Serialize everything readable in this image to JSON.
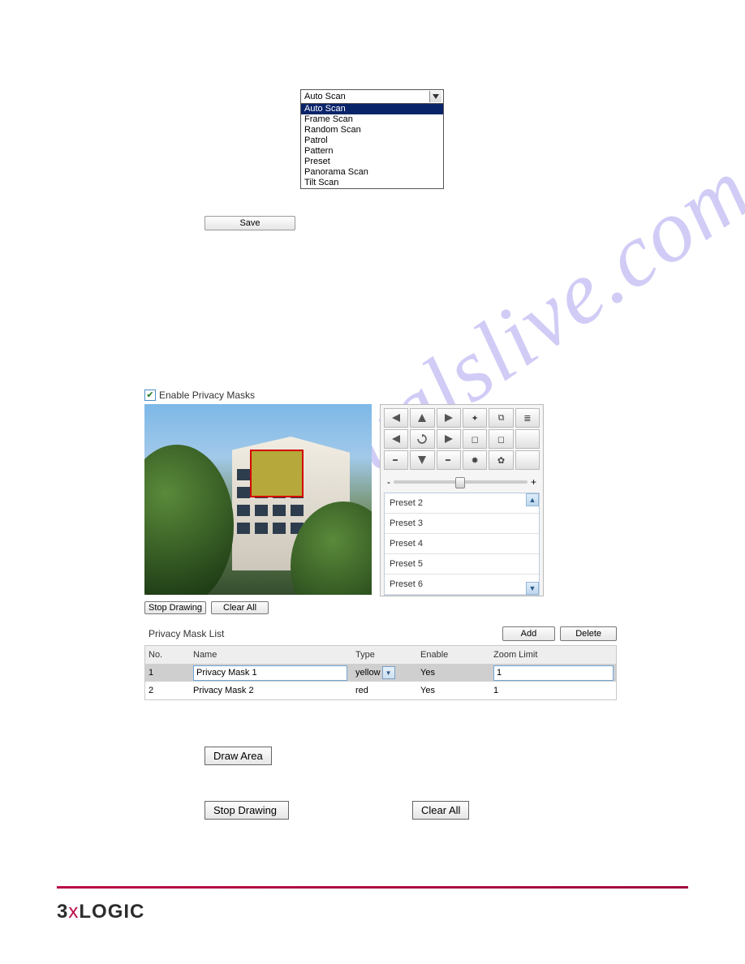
{
  "dropdown": {
    "selected": "Auto Scan",
    "items": [
      "Auto Scan",
      "Frame Scan",
      "Random Scan",
      "Patrol",
      "Pattern",
      "Preset",
      "Panorama Scan",
      "Tilt Scan"
    ]
  },
  "buttons": {
    "save": "Save",
    "stop_drawing": "Stop Drawing",
    "clear_all": "Clear All",
    "add": "Add",
    "delete": "Delete",
    "draw_area": "Draw Area",
    "stop_drawing2": "Stop Drawing",
    "clear_all2": "Clear All"
  },
  "checkbox": {
    "enable_privacy_masks": "Enable Privacy Masks"
  },
  "ptz": {
    "icons": [
      "◄",
      "▲",
      "►",
      "✦",
      "⧉",
      "≣",
      "◀",
      "⟳",
      "▶",
      "◻",
      "◻",
      " ",
      "-",
      "▼",
      "-",
      "↻",
      "⟳",
      " "
    ],
    "slider_minus": "-",
    "slider_plus": "+"
  },
  "presets": [
    "Preset 2",
    "Preset 3",
    "Preset 4",
    "Preset 5",
    "Preset 6"
  ],
  "mask_list": {
    "title": "Privacy Mask List",
    "headers": {
      "no": "No.",
      "name": "Name",
      "type": "Type",
      "enable": "Enable",
      "zoom": "Zoom Limit"
    },
    "rows": [
      {
        "no": "1",
        "name": "Privacy Mask 1",
        "type": "yellow",
        "enable": "Yes",
        "zoom": "1",
        "selected": true
      },
      {
        "no": "2",
        "name": "Privacy Mask 2",
        "type": "red",
        "enable": "Yes",
        "zoom": "1",
        "selected": false
      }
    ]
  },
  "footer": {
    "brand_pre": "3",
    "brand_x": "x",
    "brand_post": "LOGIC"
  },
  "watermark": "manualslive.com"
}
